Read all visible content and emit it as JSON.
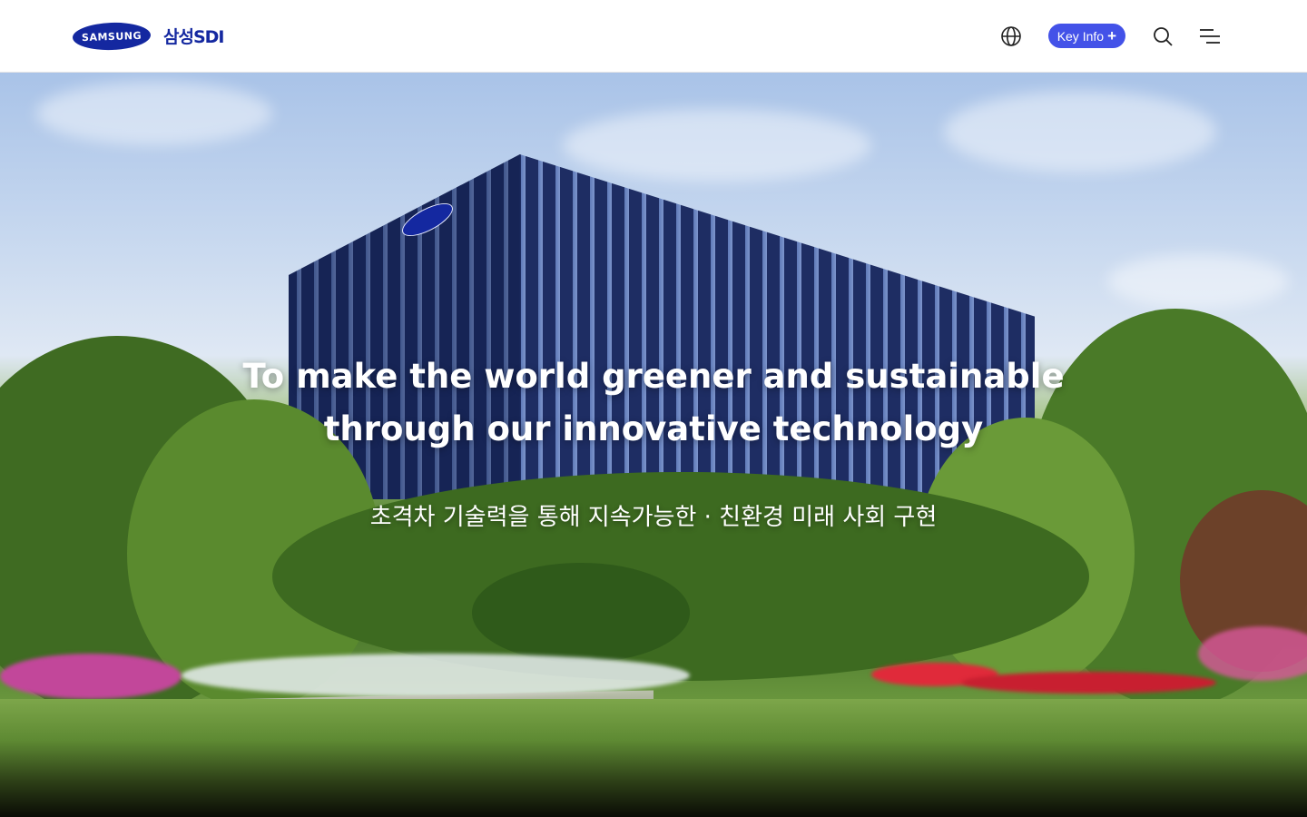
{
  "header": {
    "logo": {
      "samsung_text": "SAMSUNG",
      "sdi_text": "삼성SDI"
    },
    "actions": {
      "language_icon": "globe-icon",
      "key_info_label": "Key Info",
      "key_info_icon": "plus-icon",
      "search_icon": "search-icon",
      "menu_icon": "menu-icon"
    }
  },
  "hero": {
    "title_line1": "To make the world greener and sustainable",
    "title_line2": "through our innovative technology",
    "subtitle": "초격차 기술력을 통해 지속가능한 · 친환경 미래 사회 구현"
  },
  "colors": {
    "brand_blue": "#1428a0",
    "key_info_button": "#4352e8",
    "header_bg": "#ffffff"
  }
}
